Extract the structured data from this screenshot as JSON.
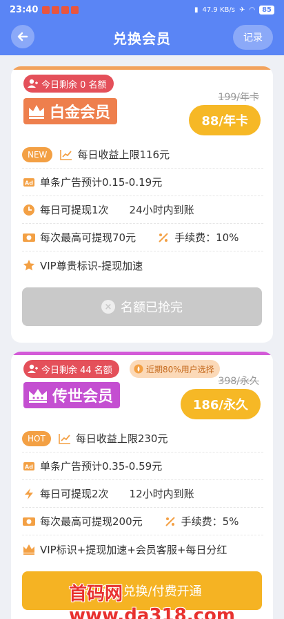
{
  "status_bar": {
    "time": "23:40",
    "network": "47.9 KB/s",
    "battery": "85"
  },
  "header": {
    "title": "兑换会员",
    "record_label": "记录"
  },
  "cards": [
    {
      "remaining_text": "今日剩余 0 名额",
      "member_name": "白金会员",
      "original_price": "199/年卡",
      "price": "88/年卡",
      "features": [
        {
          "tag": "NEW",
          "text": "每日收益上限116元"
        },
        {
          "text": "单条广告预计0.15-0.19元"
        },
        {
          "text": "每日可提现1次",
          "text2": "24小时内到账"
        },
        {
          "text": "每次最高可提现70元",
          "text2": "手续费：10%"
        },
        {
          "text": "VIP尊贵标识-提现加速"
        }
      ],
      "button_label": "名额已抢完"
    },
    {
      "remaining_text": "今日剩余 44 名额",
      "trend_text": "近期80%用户选择",
      "member_name": "传世会员",
      "original_price": "398/永久",
      "price": "186/永久",
      "features": [
        {
          "tag": "HOT",
          "text": "每日收益上限230元"
        },
        {
          "text": "单条广告预计0.35-0.59元"
        },
        {
          "text": "每日可提现2次",
          "text2": "12小时内到账"
        },
        {
          "text": "每次最高可提现200元",
          "text2": "手续费：5%"
        },
        {
          "text": "VIP标识+提现加速+会员客服+每日分红"
        }
      ],
      "button_label": "金铢兑换/付费开通"
    }
  ],
  "watermark": "首码网www.da318.com",
  "colors": {
    "primary": "#5a85f5",
    "gold": "#f6b826",
    "platinum_header": "#ee7f4d",
    "legend_header": "#c44fd1",
    "remaining_badge": "#e4505a"
  }
}
